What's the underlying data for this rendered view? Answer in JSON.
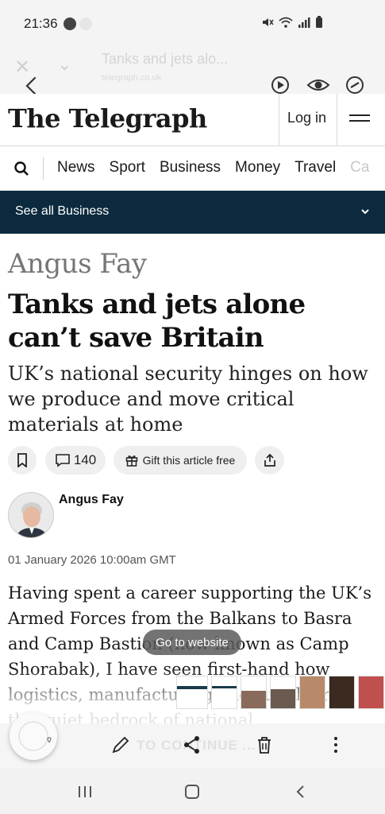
{
  "status_bar": {
    "time": "21:36"
  },
  "browser": {
    "tab_title": "Tanks and jets alo...",
    "url": "telegraph.co.uk"
  },
  "site": {
    "masthead": "The Telegraph",
    "login_label": "Log in"
  },
  "nav": {
    "items": [
      "News",
      "Sport",
      "Business",
      "Money",
      "Travel",
      "Ca"
    ]
  },
  "section_bar": {
    "label": "See all Business"
  },
  "article": {
    "author_kicker": "Angus Fay",
    "headline": "Tanks and jets alone can’t save Britain",
    "standfirst": "UK’s national security hinges on how we produce and move critical materials at home",
    "comment_count": "140",
    "gift_label": "Gift this article free",
    "byline_name": "Angus Fay",
    "date": "01 January 2026 10:00am GMT",
    "body": "Having spent a career supporting the UK’s Armed Forces from the Balkans to Basra and Camp Bastion (now known as Camp Shorabak), I have seen first-hand how logistics, manufacturing and supply from the quiet bedrock of national"
  },
  "toast": {
    "label": "Go to website"
  },
  "bottom_toolbar": {
    "cta_ghost": "TO CONTINUE ..."
  },
  "colors": {
    "section_bar_bg": "#0b2a3e",
    "kicker_gray": "#767676"
  }
}
